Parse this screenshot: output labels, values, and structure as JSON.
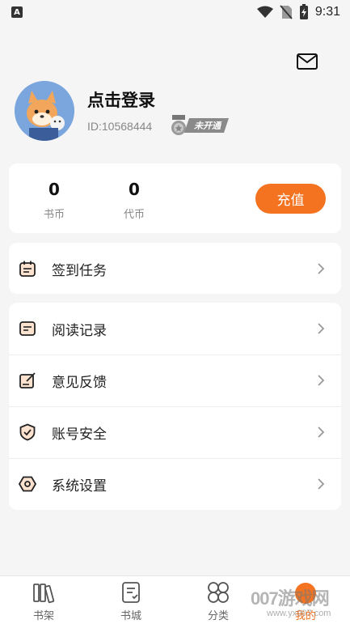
{
  "status_bar": {
    "time": "9:31",
    "notification_glyph": "A"
  },
  "header": {
    "mail_icon": "mail-icon"
  },
  "profile": {
    "title": "点击登录",
    "user_id": "ID:10568444",
    "vip_status": "未开通"
  },
  "wallet": {
    "book_coins": {
      "value": "0",
      "label": "书币"
    },
    "voucher_coins": {
      "value": "0",
      "label": "代币"
    },
    "recharge_label": "充值"
  },
  "task": {
    "label": "签到任务"
  },
  "menu": {
    "items": [
      {
        "label": "阅读记录",
        "icon": "reading-record-icon"
      },
      {
        "label": "意见反馈",
        "icon": "feedback-icon"
      },
      {
        "label": "账号安全",
        "icon": "security-shield-icon"
      },
      {
        "label": "系统设置",
        "icon": "settings-icon"
      }
    ]
  },
  "bottom_nav": {
    "items": [
      {
        "label": "书架",
        "icon": "bookshelf-icon"
      },
      {
        "label": "书城",
        "icon": "bookstore-icon"
      },
      {
        "label": "分类",
        "icon": "category-icon"
      },
      {
        "label": "我的",
        "icon": "profile-icon"
      }
    ]
  },
  "watermark": {
    "brand": "007游戏网",
    "url": "www.yx007.com"
  },
  "colors": {
    "accent": "#f47320",
    "background": "#f5f5f5",
    "card": "#ffffff",
    "text": "#222222",
    "muted": "#888888"
  }
}
